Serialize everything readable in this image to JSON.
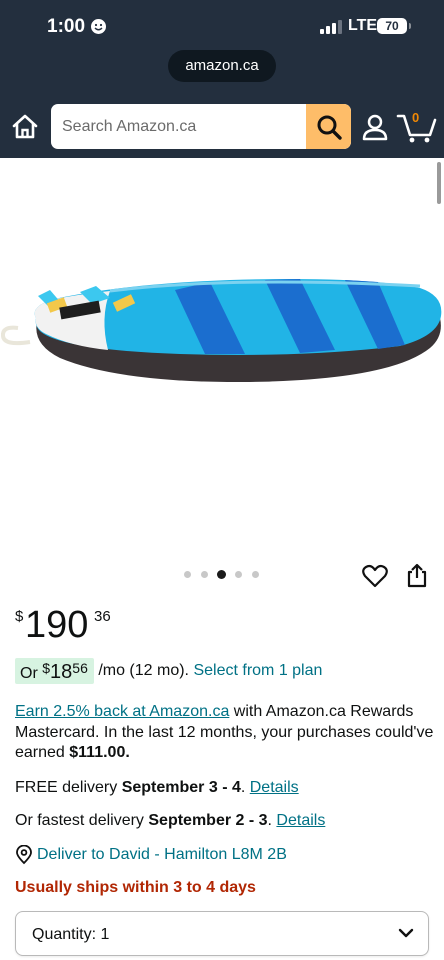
{
  "status_bar": {
    "time": "1:00",
    "network": "LTE",
    "battery": "70"
  },
  "browser": {
    "url": "amazon.ca"
  },
  "header": {
    "search_placeholder": "Search Amazon.ca",
    "cart_count": "0"
  },
  "gallery": {
    "dot_count": 5,
    "active_dot_index": 2
  },
  "price": {
    "currency": "$",
    "whole": "190",
    "fraction": "36"
  },
  "installment": {
    "prefix": "Or",
    "currency": "$",
    "whole": "18",
    "fraction": "56",
    "term": "/mo (12 mo).",
    "link": "Select from 1 plan"
  },
  "rewards": {
    "link": "Earn 2.5% back at Amazon.ca",
    "text": " with Amazon.ca Rewards Mastercard. In the last 12 months, your purchases could've earned ",
    "amount": "$111.00."
  },
  "delivery": {
    "free_prefix": "FREE delivery ",
    "free_dates": "September 3 - 4",
    "details_link": "Details",
    "fastest_prefix": "Or fastest delivery ",
    "fastest_dates": "September 2 - 3",
    "fastest_details_link": "Details",
    "deliver_to": "Deliver to David - Hamilton L8M 2B"
  },
  "availability": "Usually ships within 3 to 4 days",
  "quantity": {
    "label": "Quantity:",
    "value": "1"
  },
  "colors": {
    "header_bg": "#232f3e",
    "search_button": "#febd69",
    "link": "#007185",
    "alert": "#b12704",
    "installment_badge": "#d7f3e1"
  }
}
